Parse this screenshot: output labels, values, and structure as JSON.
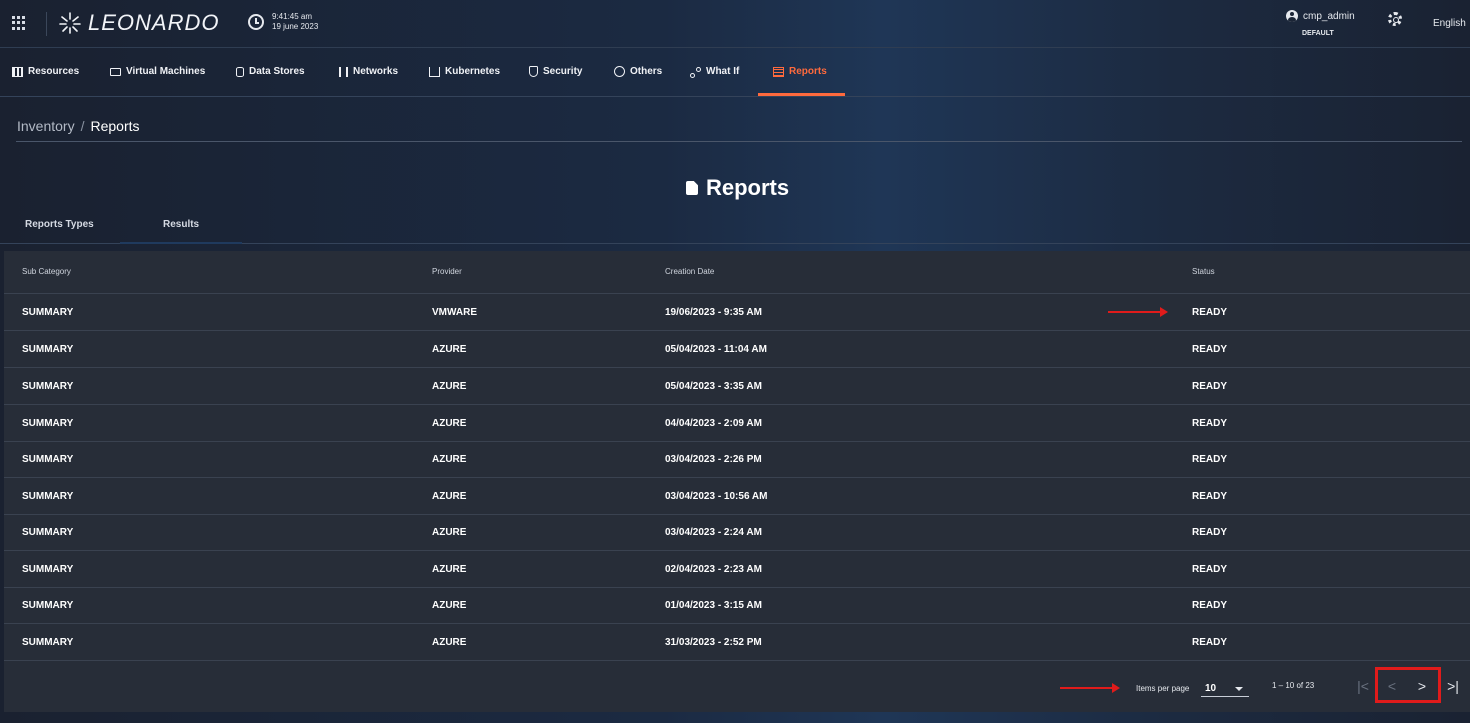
{
  "header": {
    "brand": "LEONARDO",
    "time": "9:41:45 am",
    "date": "19 june 2023",
    "username": "cmp_admin",
    "role": "DEFAULT",
    "language": "English"
  },
  "nav": {
    "items": [
      {
        "label": "Resources",
        "icon": "resources-icon"
      },
      {
        "label": "Virtual Machines",
        "icon": "monitor-icon"
      },
      {
        "label": "Data Stores",
        "icon": "database-icon"
      },
      {
        "label": "Networks",
        "icon": "network-icon"
      },
      {
        "label": "Kubernetes",
        "icon": "kubernetes-icon"
      },
      {
        "label": "Security",
        "icon": "shield-icon"
      },
      {
        "label": "Others",
        "icon": "globe-icon"
      },
      {
        "label": "What If",
        "icon": "route-icon"
      },
      {
        "label": "Reports",
        "icon": "report-icon",
        "active": true
      }
    ]
  },
  "breadcrumb": {
    "home": "Inventory",
    "separator": "/",
    "current": "Reports"
  },
  "page": {
    "title": "Reports"
  },
  "tabs": [
    {
      "label": "Reports Types"
    },
    {
      "label": "Results",
      "active": true
    }
  ],
  "table": {
    "columns": [
      "Sub Category",
      "Provider",
      "Creation Date",
      "Status"
    ],
    "rows": [
      {
        "sub_category": "SUMMARY",
        "provider": "VMWARE",
        "date": "19/06/2023 - 9:35 AM",
        "status": "READY"
      },
      {
        "sub_category": "SUMMARY",
        "provider": "AZURE",
        "date": "05/04/2023 - 11:04 AM",
        "status": "READY"
      },
      {
        "sub_category": "SUMMARY",
        "provider": "AZURE",
        "date": "05/04/2023 - 3:35 AM",
        "status": "READY"
      },
      {
        "sub_category": "SUMMARY",
        "provider": "AZURE",
        "date": "04/04/2023 - 2:09 AM",
        "status": "READY"
      },
      {
        "sub_category": "SUMMARY",
        "provider": "AZURE",
        "date": "03/04/2023 - 2:26 PM",
        "status": "READY"
      },
      {
        "sub_category": "SUMMARY",
        "provider": "AZURE",
        "date": "03/04/2023 - 10:56 AM",
        "status": "READY"
      },
      {
        "sub_category": "SUMMARY",
        "provider": "AZURE",
        "date": "03/04/2023 - 2:24 AM",
        "status": "READY"
      },
      {
        "sub_category": "SUMMARY",
        "provider": "AZURE",
        "date": "02/04/2023 - 2:23 AM",
        "status": "READY"
      },
      {
        "sub_category": "SUMMARY",
        "provider": "AZURE",
        "date": "01/04/2023 - 3:15 AM",
        "status": "READY"
      },
      {
        "sub_category": "SUMMARY",
        "provider": "AZURE",
        "date": "31/03/2023 - 2:52 PM",
        "status": "READY"
      }
    ]
  },
  "paginator": {
    "items_per_page_label": "Items per page",
    "items_per_page": "10",
    "range": "1 – 10 of 23",
    "first": "|<",
    "prev": "<",
    "next": ">",
    "last": ">|"
  },
  "colors": {
    "accent": "#ff6a3d",
    "annotation": "#e01b1b",
    "table_bg": "#272d38"
  }
}
